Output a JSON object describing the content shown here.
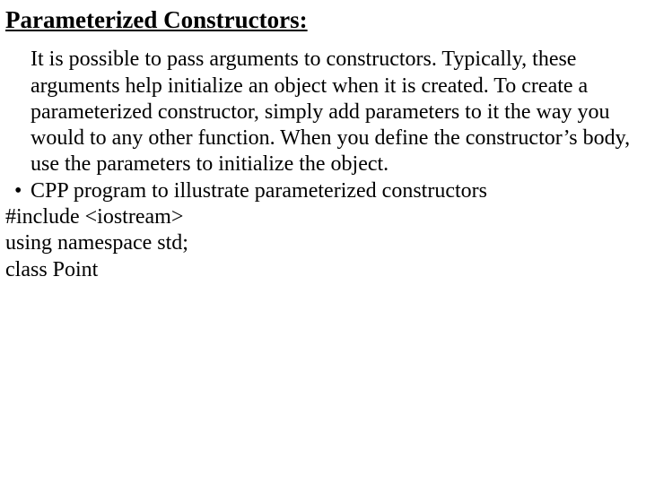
{
  "title": "Parameterized Constructors:",
  "paragraph": "It is possible to pass arguments to constructors. Typically, these arguments help initialize an object when it is created. To create a parameterized constructor, simply add parameters to it the way you would to any other function. When you define the constructor’s body, use the parameters to initialize the object.",
  "bullet_mark": "•",
  "bullet": "CPP program to illustrate parameterized constructors",
  "code": {
    "l1": "#include <iostream>",
    "l2": "using namespace std;",
    "l3": "class Point"
  }
}
